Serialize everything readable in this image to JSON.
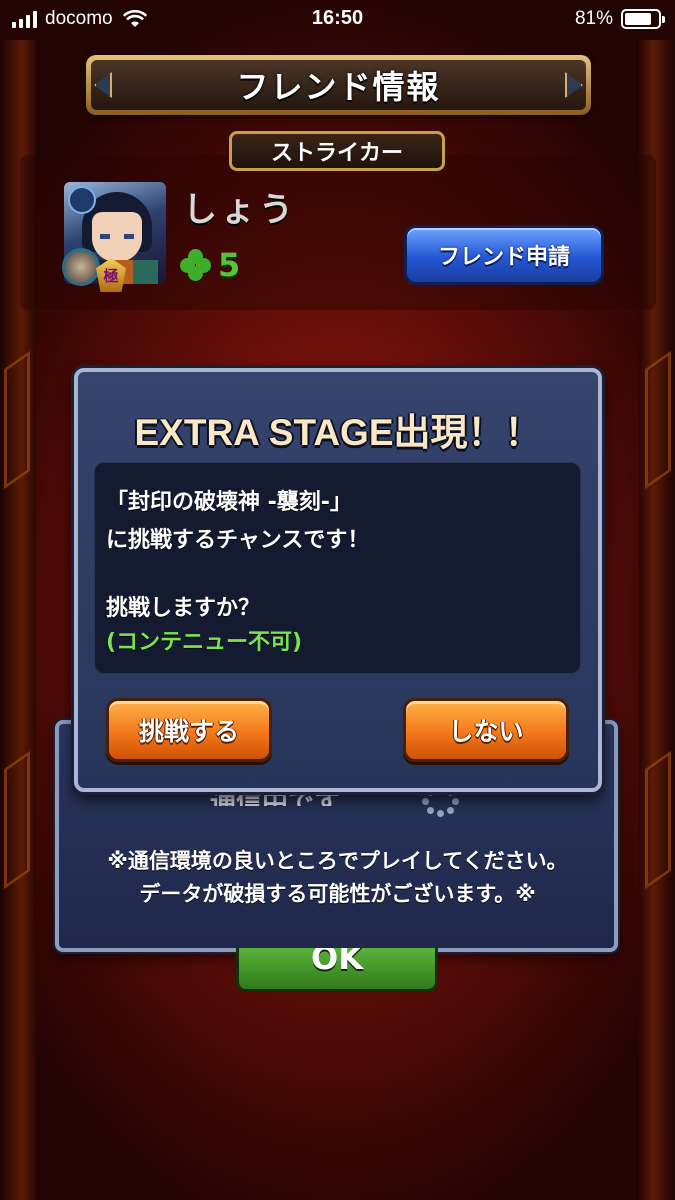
{
  "status_bar": {
    "carrier": "docomo",
    "time": "16:50",
    "battery": "81%",
    "battery_level": 0.81,
    "icons": [
      "signal-icon",
      "wifi-icon",
      "battery-icon"
    ]
  },
  "header": {
    "title": "フレンド情報",
    "role": "ストライカー"
  },
  "friend": {
    "name": "しょう",
    "level": "5",
    "rank_badge": "極",
    "request_button": "フレンド申請"
  },
  "popup": {
    "title": "EXTRA STAGE出現！！",
    "message_lines": [
      "「封印の破壊神 -襲刻-」",
      "に挑戦するチャンスです！",
      "挑戦しますか？",
      "(コンテニュー不可)"
    ],
    "challenge_button": "挑戦する",
    "decline_button": "しない"
  },
  "background_dialog": {
    "connecting": "通信中です…",
    "notice_lines": [
      "※通信環境の良いところでプレイしてください。",
      "データが破損する可能性がございます。※"
    ],
    "ok_button": "OK"
  },
  "colors": {
    "background_red": "#6a0f09",
    "popup_navy": "#27345a",
    "orange_button": "#f2781a",
    "blue_button": "#2456d4",
    "green_text": "#7be34c",
    "clover_green": "#58c23c"
  }
}
